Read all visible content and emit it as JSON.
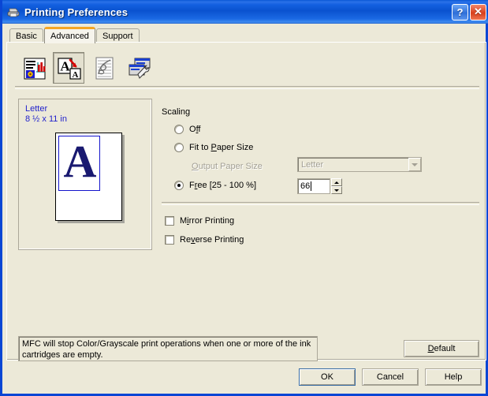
{
  "window": {
    "title": "Printing Preferences",
    "icon": "printer-icon",
    "help_button": "?",
    "close_button": "✕"
  },
  "tabs": [
    {
      "label": "Basic",
      "active": false
    },
    {
      "label": "Advanced",
      "active": true
    },
    {
      "label": "Support",
      "active": false
    }
  ],
  "toolbar": {
    "items": [
      {
        "name": "quality-icon",
        "selected": false,
        "disabled": false
      },
      {
        "name": "scaling-icon",
        "selected": true,
        "disabled": false
      },
      {
        "name": "watermark-icon",
        "selected": false,
        "disabled": true
      },
      {
        "name": "device-options-icon",
        "selected": false,
        "disabled": false
      }
    ]
  },
  "preview": {
    "paper_name": "Letter",
    "paper_size": "8 ½ x 11 in",
    "page_letter": "A"
  },
  "scaling": {
    "group_label": "Scaling",
    "options": [
      {
        "label": "Off",
        "mnemonic": "f",
        "selected": false
      },
      {
        "label": "Fit to Paper Size",
        "mnemonic": "P",
        "selected": false
      },
      {
        "label": "Free [25 - 100 %]",
        "mnemonic": "r",
        "selected": true
      }
    ],
    "output_paper_size_label": "Output Paper Size",
    "output_paper_size_value": "Letter",
    "output_paper_size_disabled": true,
    "free_value": "66"
  },
  "checkboxes": [
    {
      "label": "Mirror Printing",
      "checked": false
    },
    {
      "label": "Reverse Printing",
      "checked": false
    }
  ],
  "status": {
    "message": "MFC will stop Color/Grayscale print operations when one or more of the ink cartridges are empty."
  },
  "buttons": {
    "default": "Default",
    "ok": "OK",
    "cancel": "Cancel",
    "help": "Help"
  },
  "colors": {
    "titlebar_blue": "#0a52cf",
    "window_border": "#0a46d4",
    "face": "#ece9d8",
    "tab_active_accent": "#f5a623",
    "preview_text": "#2222cc",
    "preview_letter": "#191970"
  }
}
